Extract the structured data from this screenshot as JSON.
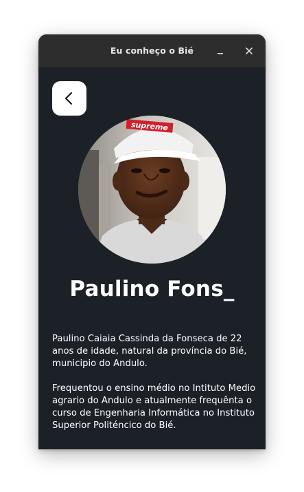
{
  "window": {
    "title": "Eu conheço o Bié"
  },
  "controls": {
    "minimize_icon": "minimize-icon",
    "close_icon": "close-icon",
    "back_icon": "chevron-left-icon"
  },
  "profile": {
    "name": "Paulino Fons_",
    "cap_text": "supreme",
    "bio": [
      "Paulino Caiaia Cassinda da Fonseca de 22 anos de idade, natural da província do Bié, municipio do Andulo.",
      "Frequentou o ensino médio no Intituto Medio agrario do Andulo e atualmente frequênta o curso de Engenharia Informática no Instituto Superior Politéncico do Bié."
    ]
  },
  "colors": {
    "background": "#1b2126",
    "titlebar": "#2d2d2d",
    "text": "#ffffff"
  }
}
